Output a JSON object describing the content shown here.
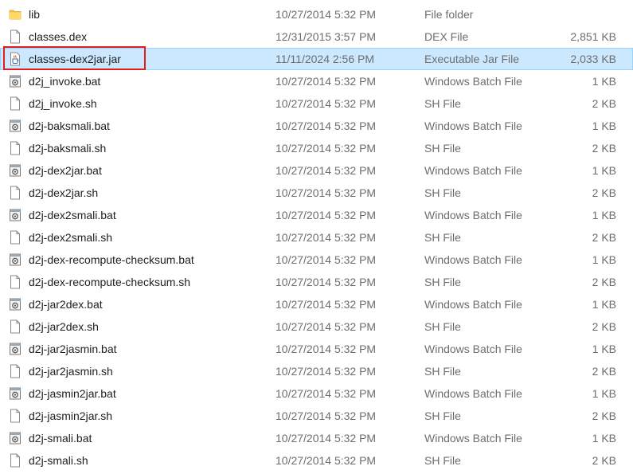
{
  "files": [
    {
      "name": "lib",
      "date": "10/27/2014 5:32 PM",
      "type": "File folder",
      "size": "",
      "icon": "folder-icon"
    },
    {
      "name": "classes.dex",
      "date": "12/31/2015 3:57 PM",
      "type": "DEX File",
      "size": "2,851 KB",
      "icon": "file-icon"
    },
    {
      "name": "classes-dex2jar.jar",
      "date": "11/11/2024 2:56 PM",
      "type": "Executable Jar File",
      "size": "2,033 KB",
      "icon": "jar-icon",
      "selected": true
    },
    {
      "name": "d2j_invoke.bat",
      "date": "10/27/2014 5:32 PM",
      "type": "Windows Batch File",
      "size": "1 KB",
      "icon": "batch-file-icon"
    },
    {
      "name": "d2j_invoke.sh",
      "date": "10/27/2014 5:32 PM",
      "type": "SH File",
      "size": "2 KB",
      "icon": "file-icon"
    },
    {
      "name": "d2j-baksmali.bat",
      "date": "10/27/2014 5:32 PM",
      "type": "Windows Batch File",
      "size": "1 KB",
      "icon": "batch-file-icon"
    },
    {
      "name": "d2j-baksmali.sh",
      "date": "10/27/2014 5:32 PM",
      "type": "SH File",
      "size": "2 KB",
      "icon": "file-icon"
    },
    {
      "name": "d2j-dex2jar.bat",
      "date": "10/27/2014 5:32 PM",
      "type": "Windows Batch File",
      "size": "1 KB",
      "icon": "batch-file-icon"
    },
    {
      "name": "d2j-dex2jar.sh",
      "date": "10/27/2014 5:32 PM",
      "type": "SH File",
      "size": "2 KB",
      "icon": "file-icon"
    },
    {
      "name": "d2j-dex2smali.bat",
      "date": "10/27/2014 5:32 PM",
      "type": "Windows Batch File",
      "size": "1 KB",
      "icon": "batch-file-icon"
    },
    {
      "name": "d2j-dex2smali.sh",
      "date": "10/27/2014 5:32 PM",
      "type": "SH File",
      "size": "2 KB",
      "icon": "file-icon"
    },
    {
      "name": "d2j-dex-recompute-checksum.bat",
      "date": "10/27/2014 5:32 PM",
      "type": "Windows Batch File",
      "size": "1 KB",
      "icon": "batch-file-icon"
    },
    {
      "name": "d2j-dex-recompute-checksum.sh",
      "date": "10/27/2014 5:32 PM",
      "type": "SH File",
      "size": "2 KB",
      "icon": "file-icon"
    },
    {
      "name": "d2j-jar2dex.bat",
      "date": "10/27/2014 5:32 PM",
      "type": "Windows Batch File",
      "size": "1 KB",
      "icon": "batch-file-icon"
    },
    {
      "name": "d2j-jar2dex.sh",
      "date": "10/27/2014 5:32 PM",
      "type": "SH File",
      "size": "2 KB",
      "icon": "file-icon"
    },
    {
      "name": "d2j-jar2jasmin.bat",
      "date": "10/27/2014 5:32 PM",
      "type": "Windows Batch File",
      "size": "1 KB",
      "icon": "batch-file-icon"
    },
    {
      "name": "d2j-jar2jasmin.sh",
      "date": "10/27/2014 5:32 PM",
      "type": "SH File",
      "size": "2 KB",
      "icon": "file-icon"
    },
    {
      "name": "d2j-jasmin2jar.bat",
      "date": "10/27/2014 5:32 PM",
      "type": "Windows Batch File",
      "size": "1 KB",
      "icon": "batch-file-icon"
    },
    {
      "name": "d2j-jasmin2jar.sh",
      "date": "10/27/2014 5:32 PM",
      "type": "SH File",
      "size": "2 KB",
      "icon": "file-icon"
    },
    {
      "name": "d2j-smali.bat",
      "date": "10/27/2014 5:32 PM",
      "type": "Windows Batch File",
      "size": "1 KB",
      "icon": "batch-file-icon"
    },
    {
      "name": "d2j-smali.sh",
      "date": "10/27/2014 5:32 PM",
      "type": "SH File",
      "size": "2 KB",
      "icon": "file-icon"
    }
  ],
  "colors": {
    "selection_background": "#cce8ff",
    "selection_border": "#99d1ff",
    "highlight_border": "#e01e1e",
    "secondary_text": "#6d6d6d",
    "folder": "#f0c24a"
  }
}
